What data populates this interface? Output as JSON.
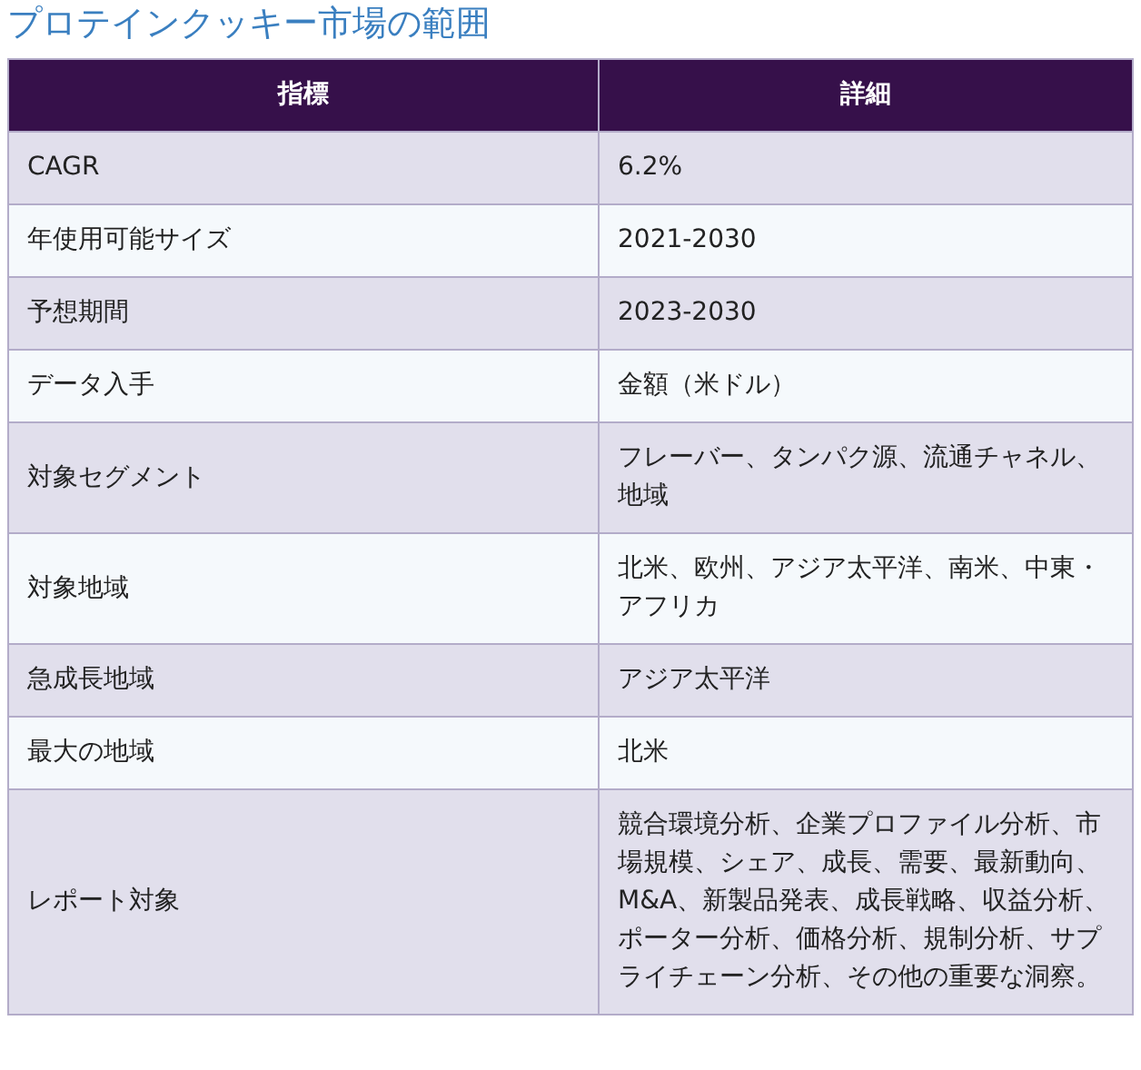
{
  "title": "プロテインクッキー市場の範囲",
  "table": {
    "columns": [
      "指標",
      "詳細"
    ],
    "rows": [
      {
        "label": "CAGR",
        "value": "6.2%"
      },
      {
        "label": "年使用可能サイズ",
        "value": "2021-2030"
      },
      {
        "label": "予想期間",
        "value": "2023-2030"
      },
      {
        "label": "データ入手",
        "value": "金額（米ドル）"
      },
      {
        "label": "対象セグメント",
        "value": "フレーバー、タンパク源、流通チャネル、地域"
      },
      {
        "label": "対象地域",
        "value": "北米、欧州、アジア太平洋、南米、中東・アフリカ"
      },
      {
        "label": "急成長地域",
        "value": "アジア太平洋"
      },
      {
        "label": "最大の地域",
        "value": "北米"
      },
      {
        "label": "レポート対象",
        "value": "競合環境分析、企業プロファイル分析、市場規模、シェア、成長、需要、最新動向、M&A、新製品発表、成長戦略、収益分析、ポーター分析、価格分析、規制分析、サプライチェーン分析、その他の重要な洞察。"
      }
    ]
  }
}
